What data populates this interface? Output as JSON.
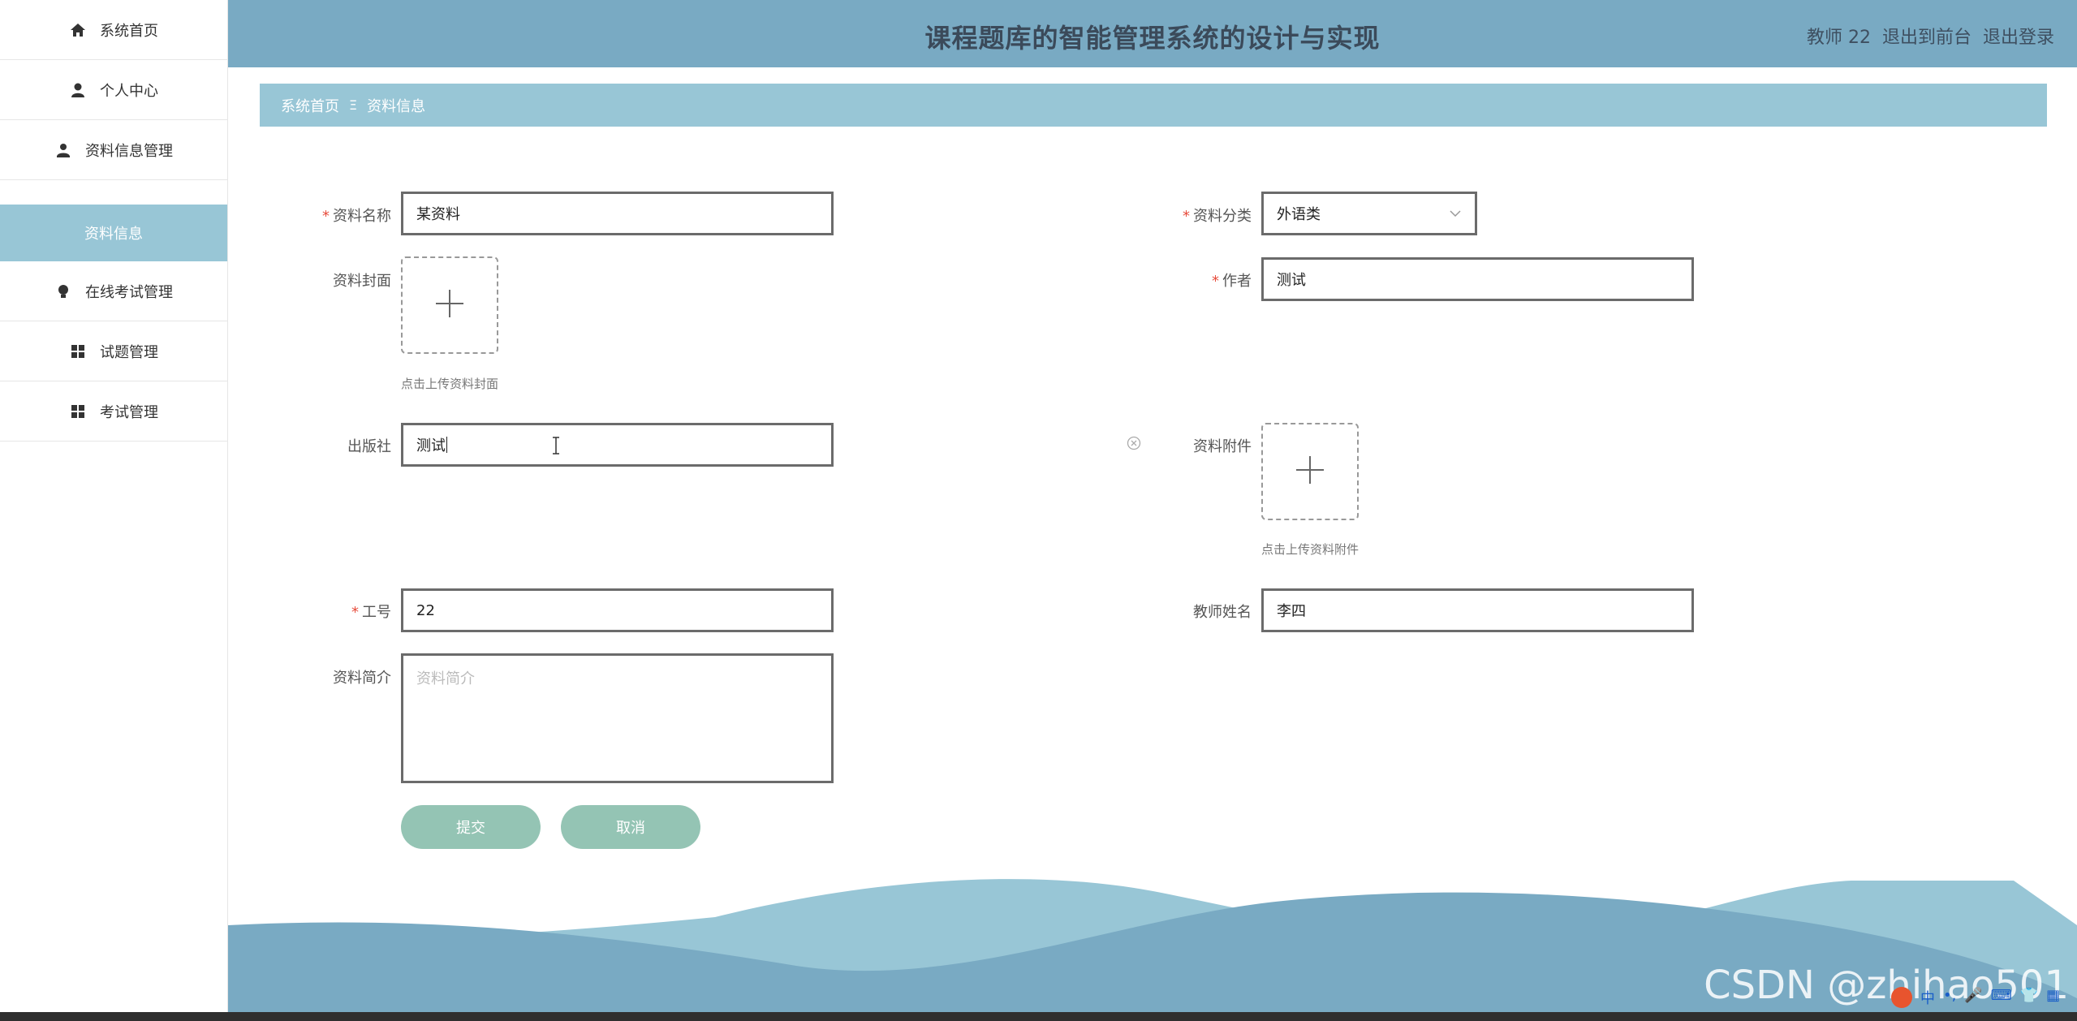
{
  "sidebar": {
    "items": [
      {
        "label": "系统首页",
        "icon": "home-icon"
      },
      {
        "label": "个人中心",
        "icon": "user-icon"
      },
      {
        "label": "资料信息管理",
        "icon": "user-group-icon"
      },
      {
        "label": "资料信息",
        "icon": ""
      },
      {
        "label": "在线考试管理",
        "icon": "bulb-icon"
      },
      {
        "label": "试题管理",
        "icon": "grid-icon"
      },
      {
        "label": "考试管理",
        "icon": "grid-icon"
      }
    ]
  },
  "header": {
    "title": "课程题库的智能管理系统的设计与实现",
    "user": "教师 22",
    "back_front": "退出到前台",
    "logout": "退出登录"
  },
  "breadcrumb": {
    "home": "系统首页",
    "separator": "Ξ",
    "current": "资料信息"
  },
  "form": {
    "name_label": "资料名称",
    "name_value": "某资料",
    "category_label": "资料分类",
    "category_value": "外语类",
    "cover_label": "资料封面",
    "cover_hint": "点击上传资料封面",
    "author_label": "作者",
    "author_value": "测试",
    "publisher_label": "出版社",
    "publisher_value": "测试",
    "attachment_label": "资料附件",
    "attachment_hint": "点击上传资料附件",
    "job_no_label": "工号",
    "job_no_value": "22",
    "teacher_name_label": "教师姓名",
    "teacher_name_value": "李四",
    "intro_label": "资料简介",
    "intro_placeholder": "资料简介",
    "submit": "提交",
    "cancel": "取消"
  },
  "watermark": "CSDN @zhihao501",
  "tray": {
    "ime": "中"
  },
  "colors": {
    "header": "#79aac3",
    "breadcrumb": "#98c6d6",
    "button": "#94c4b4",
    "wave_light": "#98c6d6",
    "wave_dark": "#79aac3"
  }
}
